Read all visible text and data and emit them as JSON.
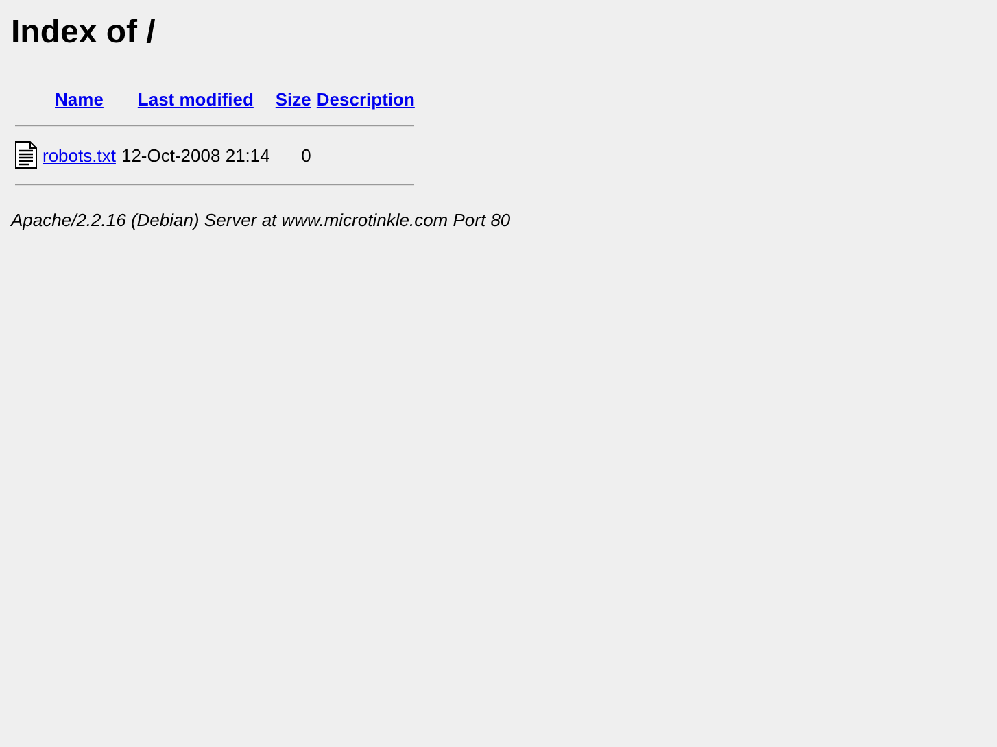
{
  "title": "Index of /",
  "table": {
    "columns": [
      "Name",
      "Last modified",
      "Size",
      "Description"
    ],
    "rows": [
      {
        "name": "robots.txt",
        "last_modified": "12-Oct-2008 21:14",
        "size": "0"
      }
    ]
  },
  "footer": "Apache/2.2.16 (Debian) Server at www.microtinkle.com Port 80"
}
